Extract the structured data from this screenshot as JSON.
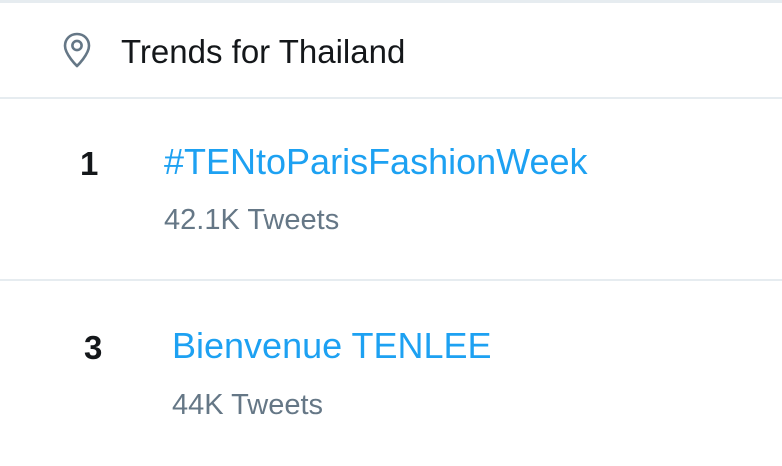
{
  "header": {
    "icon": "location-pin-icon",
    "title": "Trends for Thailand"
  },
  "trends": [
    {
      "rank": "1",
      "name": "#TENtoParisFashionWeek",
      "count": "42.1K Tweets"
    },
    {
      "rank": "3",
      "name": "Bienvenue TENLEE",
      "count": "44K Tweets"
    }
  ],
  "colors": {
    "link": "#1da1f2",
    "text": "#14171a",
    "secondary": "#657786",
    "divider": "#e6ecf0"
  }
}
